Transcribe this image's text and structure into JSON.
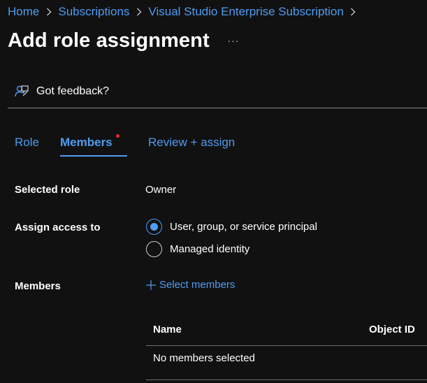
{
  "breadcrumb": {
    "items": [
      "Home",
      "Subscriptions",
      "Visual Studio Enterprise Subscription"
    ]
  },
  "title": "Add role assignment",
  "more_label": "···",
  "feedback": {
    "label": "Got feedback?",
    "icon": "feedback-person-icon"
  },
  "tabs": [
    {
      "label": "Role",
      "active": false
    },
    {
      "label": "Members",
      "active": true,
      "has_error_dot": true
    },
    {
      "label": "Review + assign",
      "active": false
    }
  ],
  "form": {
    "selected_role_label": "Selected role",
    "selected_role_value": "Owner",
    "assign_access_label": "Assign access to",
    "assign_options": [
      {
        "label": "User, group, or service principal",
        "checked": true
      },
      {
        "label": "Managed identity",
        "checked": false
      }
    ],
    "members_label": "Members",
    "select_members_label": "Select members"
  },
  "table": {
    "columns": [
      "Name",
      "Object ID"
    ],
    "empty_text": "No members selected"
  },
  "colors": {
    "background": "#111111",
    "accent": "#4f9cf2",
    "error_dot": "#e8282b"
  }
}
